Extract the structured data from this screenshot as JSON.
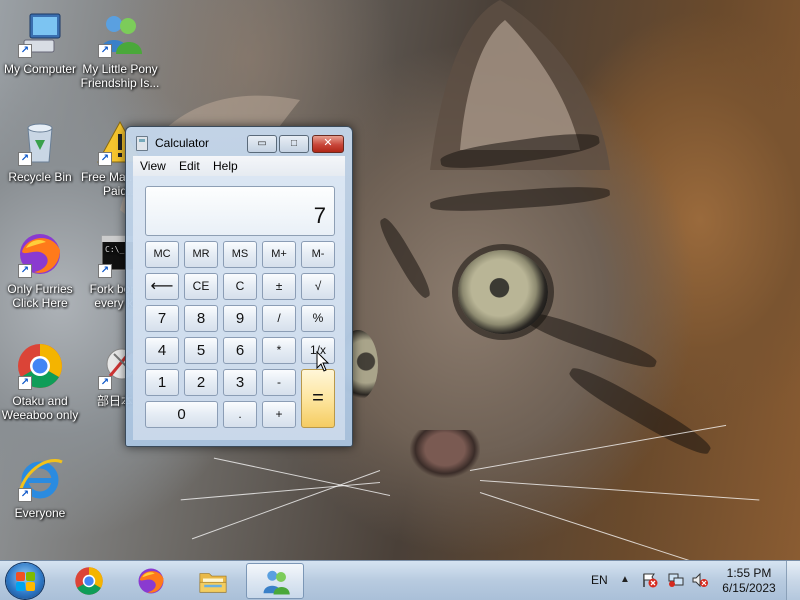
{
  "desktop": {
    "icons": [
      {
        "label": "My Computer",
        "icon": "computer-icon"
      },
      {
        "label": "My Little Pony Friendship Is...",
        "icon": "users-icon"
      },
      {
        "label": "Recycle Bin",
        "icon": "recycle-bin-icon"
      },
      {
        "label": "Free Ma... and Paid...",
        "icon": "warning-icon"
      },
      {
        "label": "Only Furries Click Here",
        "icon": "firefox-icon"
      },
      {
        "label": "Fork bom... every ki...",
        "icon": "cmd-icon"
      },
      {
        "label": "Otaku and Weeaboo only",
        "icon": "chrome-icon"
      },
      {
        "label": "部日本...",
        "icon": "tool-icon"
      },
      {
        "label": "Everyone",
        "icon": "internet-explorer-icon"
      }
    ]
  },
  "calculator": {
    "title": "Calculator",
    "menu": [
      "View",
      "Edit",
      "Help"
    ],
    "display": "7",
    "buttons": {
      "mc": "MC",
      "mr": "MR",
      "ms": "MS",
      "mplus": "M+",
      "mminus": "M-",
      "backspace": "⟵",
      "ce": "CE",
      "c": "C",
      "plusminus": "±",
      "sqrt": "√",
      "n7": "7",
      "n8": "8",
      "n9": "9",
      "divide": "/",
      "percent": "%",
      "n4": "4",
      "n5": "5",
      "n6": "6",
      "multiply": "*",
      "reciprocal": "1/x",
      "n1": "1",
      "n2": "2",
      "n3": "3",
      "minus": "-",
      "equals": "=",
      "n0": "0",
      "dot": ".",
      "plus": "+"
    },
    "window_buttons": {
      "minimize": "▭",
      "maximize": "□",
      "close": "✕"
    }
  },
  "taskbar": {
    "items": [
      "start-orb-icon",
      "chrome-icon",
      "firefox-icon",
      "file-explorer-icon",
      "users-icon"
    ],
    "language": "EN",
    "tray_icons": [
      "action-center-flag-icon",
      "network-icon",
      "volume-muted-icon"
    ],
    "time": "1:55 PM",
    "date": "6/15/2023"
  },
  "colors": {
    "window_frame": "#c4d6ea",
    "equals_key": "#fde6a0",
    "taskbar": "#b4c8de"
  }
}
